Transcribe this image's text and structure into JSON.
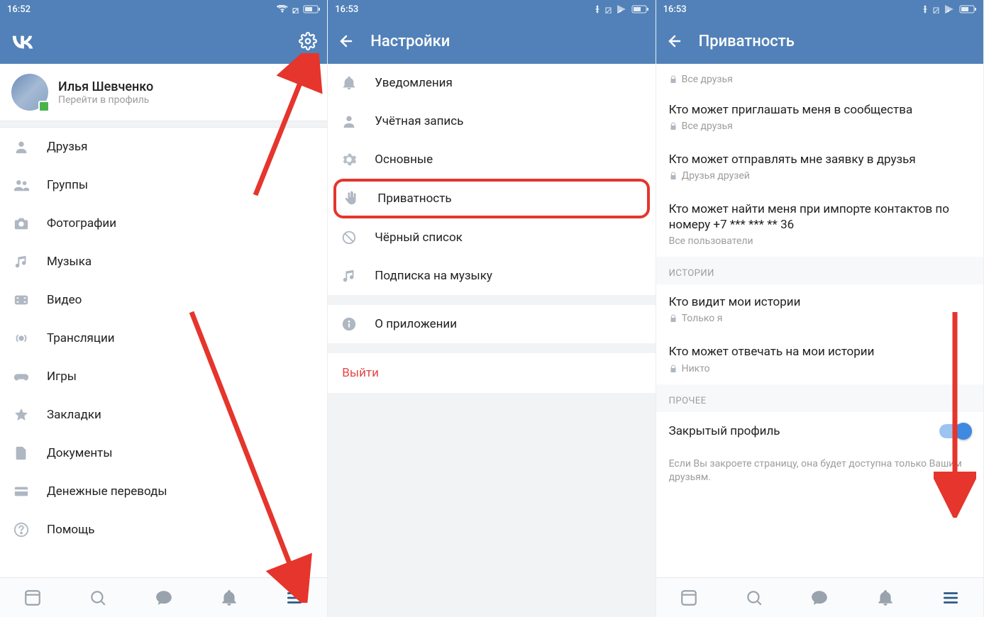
{
  "status": {
    "time1": "16:52",
    "time2": "16:53",
    "time3": "16:53"
  },
  "screen1": {
    "profile_name": "Илья Шевченко",
    "profile_sub": "Перейти в профиль",
    "menu": [
      {
        "label": "Друзья",
        "icon": "person"
      },
      {
        "label": "Группы",
        "icon": "people"
      },
      {
        "label": "Фотографии",
        "icon": "camera"
      },
      {
        "label": "Музыка",
        "icon": "music"
      },
      {
        "label": "Видео",
        "icon": "video"
      },
      {
        "label": "Трансляции",
        "icon": "broadcast"
      },
      {
        "label": "Игры",
        "icon": "gamepad"
      },
      {
        "label": "Закладки",
        "icon": "star"
      },
      {
        "label": "Документы",
        "icon": "document"
      },
      {
        "label": "Денежные переводы",
        "icon": "card"
      },
      {
        "label": "Помощь",
        "icon": "help"
      }
    ]
  },
  "screen2": {
    "title": "Настройки",
    "items": [
      {
        "label": "Уведомления",
        "icon": "bell"
      },
      {
        "label": "Учётная запись",
        "icon": "person"
      },
      {
        "label": "Основные",
        "icon": "gear"
      },
      {
        "label": "Приватность",
        "icon": "hand",
        "highlighted": true
      },
      {
        "label": "Чёрный список",
        "icon": "block"
      },
      {
        "label": "Подписка на музыку",
        "icon": "music"
      }
    ],
    "about": "О приложении",
    "logout": "Выйти"
  },
  "screen3": {
    "title": "Приватность",
    "top_val": "Все друзья",
    "rows": [
      {
        "title": "Кто может приглашать меня в сообщества",
        "val": "Все друзья",
        "lock": true
      },
      {
        "title": "Кто может отправлять мне заявку в друзья",
        "val": "Друзья друзей",
        "lock": true
      },
      {
        "title": "Кто может найти меня при импорте контактов по номеру +7 *** *** ** 36",
        "val": "Все пользователи",
        "lock": false
      }
    ],
    "sect_stories": "ИСТОРИИ",
    "stories": [
      {
        "title": "Кто видит мои истории",
        "val": "Только я"
      },
      {
        "title": "Кто может отвечать на мои истории",
        "val": "Никто"
      }
    ],
    "sect_other": "ПРОЧЕЕ",
    "closed_profile": "Закрытый профиль",
    "note": "Если Вы закроете страницу, она будет доступна только Вашим друзьям."
  }
}
